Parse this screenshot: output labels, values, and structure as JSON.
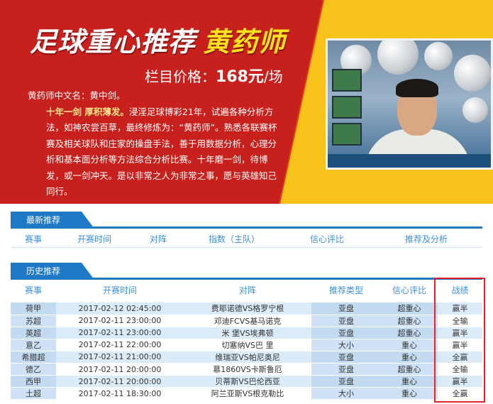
{
  "hero": {
    "title": "足球重心推荐",
    "title_highlight": "黄药师",
    "price_label": "栏目价格：",
    "price_value": "168元",
    "price_unit": "/场",
    "intro_line1": "黄药师中文名：黄中剑。",
    "intro_motto": "十年一剑 厚积薄发。",
    "intro_body": "浸淫足球博彩21年，试遍各种分析方法，如神农尝百草，最终修炼为：“黄药师”。熟悉各联赛杯赛及相关球队和庄家的操盘手法，善于用数据分析，心理分析和基本面分析等方法综合分析比赛。十年磨一剑，待博发，或一剑冲天。是以非常之人为非常之事，愿与英雄知己同行。"
  },
  "latest": {
    "tab": "最新推荐",
    "columns": [
      "赛事",
      "开赛时间",
      "对阵",
      "指数（主队）",
      "信心评比",
      "推荐及分析"
    ]
  },
  "history": {
    "tab": "历史推荐",
    "columns": [
      "赛事",
      "开赛时间",
      "对阵",
      "推荐类型",
      "信心评比",
      "战绩"
    ],
    "rows": [
      {
        "league": "荷甲",
        "time": "2017-02-12 02:45:00",
        "match": "费耶诺德VS格罗宁根",
        "type": "亚盘",
        "confidence": "超重心",
        "result": "赢半"
      },
      {
        "league": "苏超",
        "time": "2017-02-11 23:00:00",
        "match": "邓迪FCVS基马诺克",
        "type": "亚盘",
        "confidence": "超重心",
        "result": "全输"
      },
      {
        "league": "英超",
        "time": "2017-02-11 23:00:00",
        "match": "米 堡VS埃弗顿",
        "type": "亚盘",
        "confidence": "超重心",
        "result": "赢半"
      },
      {
        "league": "意乙",
        "time": "2017-02-11 22:00:00",
        "match": "切塞纳VS巴 里",
        "type": "大小",
        "confidence": "重心",
        "result": "赢半"
      },
      {
        "league": "希腊超",
        "time": "2017-02-11 21:00:00",
        "match": "维瑞亚VS帕尼奥尼",
        "type": "亚盘",
        "confidence": "重心",
        "result": "全赢"
      },
      {
        "league": "德乙",
        "time": "2017-02-11 20:00:00",
        "match": "慕1860VS卡斯鲁厄",
        "type": "亚盘",
        "confidence": "超重心",
        "result": "全输"
      },
      {
        "league": "西甲",
        "time": "2017-02-11 20:00:00",
        "match": "贝蒂斯VS巴伦西亚",
        "type": "亚盘",
        "confidence": "重心",
        "result": "赢半"
      },
      {
        "league": "土超",
        "time": "2017-02-11 18:30:00",
        "match": "阿兰亚斯VS根克勒比",
        "type": "大小",
        "confidence": "重心",
        "result": "全赢"
      }
    ]
  },
  "colors": {
    "hero_red": "#c8201c",
    "hero_yellow": "#f7c21a",
    "accent_blue": "#1f79c7",
    "row_blue": "#dcebf8",
    "highlight_red": "#e8202a"
  }
}
